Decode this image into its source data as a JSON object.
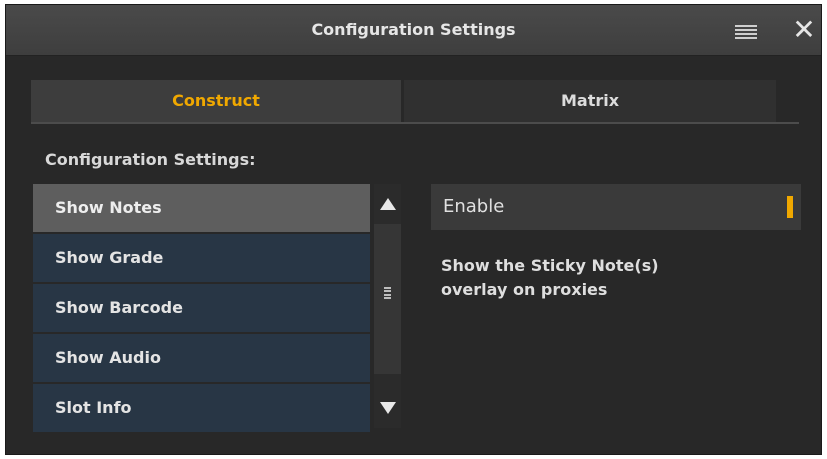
{
  "window": {
    "title": "Configuration Settings",
    "menu_icon": "hamburger-icon",
    "close_icon": "close-icon",
    "close_glyph": "✕"
  },
  "tabs": [
    {
      "label": "Construct",
      "active": true
    },
    {
      "label": "Matrix",
      "active": false
    }
  ],
  "section_label": "Configuration Settings:",
  "settings_list": {
    "items": [
      {
        "label": "Show Notes",
        "selected": true
      },
      {
        "label": "Show Grade",
        "selected": false
      },
      {
        "label": "Show Barcode",
        "selected": false
      },
      {
        "label": "Show Audio",
        "selected": false
      },
      {
        "label": "Slot Info",
        "selected": false
      }
    ]
  },
  "detail": {
    "value": "Enable",
    "description_lines": [
      "Show the Sticky Note(s)",
      "overlay on proxies"
    ]
  },
  "colors": {
    "accent": "#f0a800",
    "window_bg": "#282828",
    "list_item_bg": "#283645",
    "list_item_selected_bg": "#5e5e5e"
  }
}
